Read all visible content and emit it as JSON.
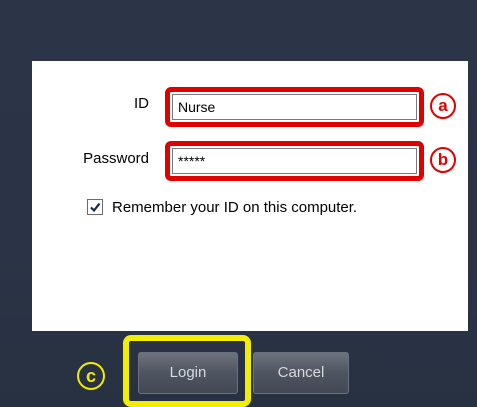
{
  "form": {
    "id_label": "ID",
    "id_value": "Nurse",
    "password_label": "Password",
    "password_value": "*****",
    "remember_label": "Remember your ID on this computer.",
    "remember_checked": true
  },
  "buttons": {
    "login_label": "Login",
    "cancel_label": "Cancel"
  },
  "annotations": {
    "a": "ⓐ",
    "b": "ⓑ",
    "c": "ⓒ"
  },
  "colors": {
    "window_bg": "#2b3547",
    "panel_bg": "#ffffff",
    "highlight_red": "#e00000",
    "highlight_yellow": "#f2ee00",
    "button_text": "#d7d9dd"
  },
  "icons": {
    "checkbox": "checkmark-icon"
  }
}
